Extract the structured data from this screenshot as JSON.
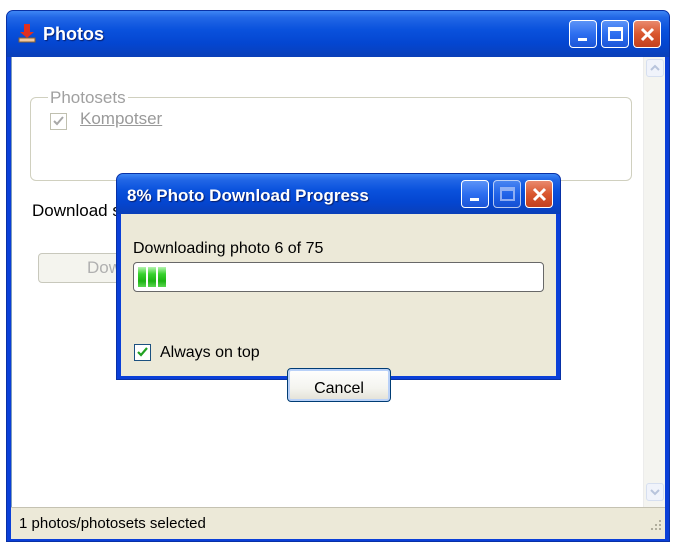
{
  "main_window": {
    "title": "Photos",
    "photosets_legend": "Photosets",
    "photosets": [
      {
        "label": "Kompotser",
        "checked": true,
        "enabled": false
      }
    ],
    "download_label": "Download s",
    "download_button_label": "Dow",
    "status_text": "1 photos/photosets selected"
  },
  "progress_dialog": {
    "title": "8% Photo Download Progress",
    "status_text": "Downloading photo 6 of 75",
    "progress_fraction": 0.08,
    "always_on_top_label": "Always on top",
    "always_on_top_checked": true,
    "cancel_label": "Cancel"
  },
  "icons": {
    "main_title_icon": "download-icon",
    "minimize": "minimize-icon",
    "maximize": "maximize-icon",
    "close": "close-icon",
    "scroll_up": "scroll-up-arrow-icon",
    "scroll_down": "scroll-down-arrow-icon",
    "grip": "resize-grip-icon",
    "check": "checkmark-icon"
  },
  "colors": {
    "titlebar_blue": "#0a52dd",
    "close_red": "#d9572f",
    "progress_green": "#1cb313",
    "dialog_face": "#ece9d8"
  }
}
